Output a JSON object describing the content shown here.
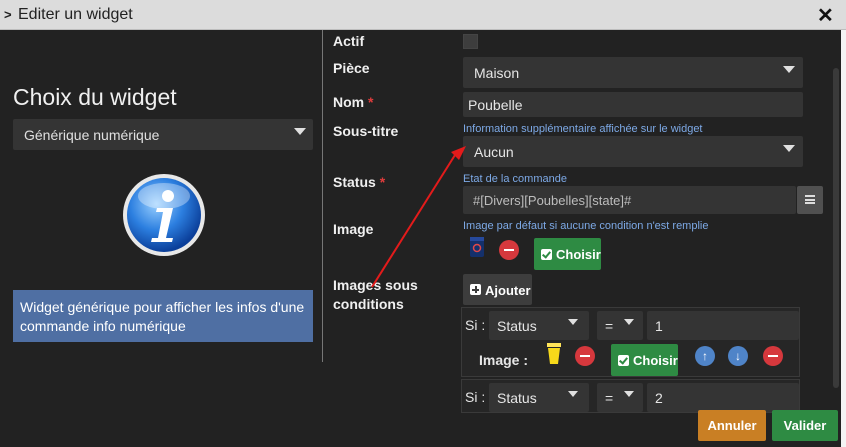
{
  "window": {
    "title": "Editer un widget"
  },
  "left": {
    "heading": "Choix du widget",
    "widget_type": "Générique numérique",
    "description": "Widget générique pour afficher les infos d'une commande info numérique"
  },
  "form": {
    "actif": {
      "label": "Actif"
    },
    "piece": {
      "label": "Pièce",
      "value": "Maison"
    },
    "nom": {
      "label": "Nom",
      "required": "*",
      "value": "Poubelle"
    },
    "sous_titre": {
      "label": "Sous-titre",
      "hint": "Information supplémentaire affichée sur le widget",
      "value": "Aucun"
    },
    "status": {
      "label": "Status",
      "required": "*",
      "hint": "Etat de la commande",
      "value": "#[Divers][Poubelles][state]#"
    },
    "image": {
      "label": "Image",
      "hint": "Image par défaut si aucune condition n'est remplie",
      "choose_label": "Choisir"
    },
    "images_conditions": {
      "label": "Images sous conditions",
      "add_label": "Ajouter",
      "conditions": [
        {
          "si": "Si :",
          "field": "Status",
          "op": "=",
          "value": "1",
          "image_label": "Image :",
          "choose_label": "Choisir"
        },
        {
          "si": "Si :",
          "field": "Status",
          "op": "=",
          "value": "2"
        }
      ]
    }
  },
  "footer": {
    "cancel": "Annuler",
    "ok": "Valider"
  },
  "colors": {
    "accent_blue": "#4f6fa3",
    "green": "#2e8b43",
    "orange": "#c97f24",
    "red": "#d6383d",
    "arrow_red": "#e31b1b"
  }
}
